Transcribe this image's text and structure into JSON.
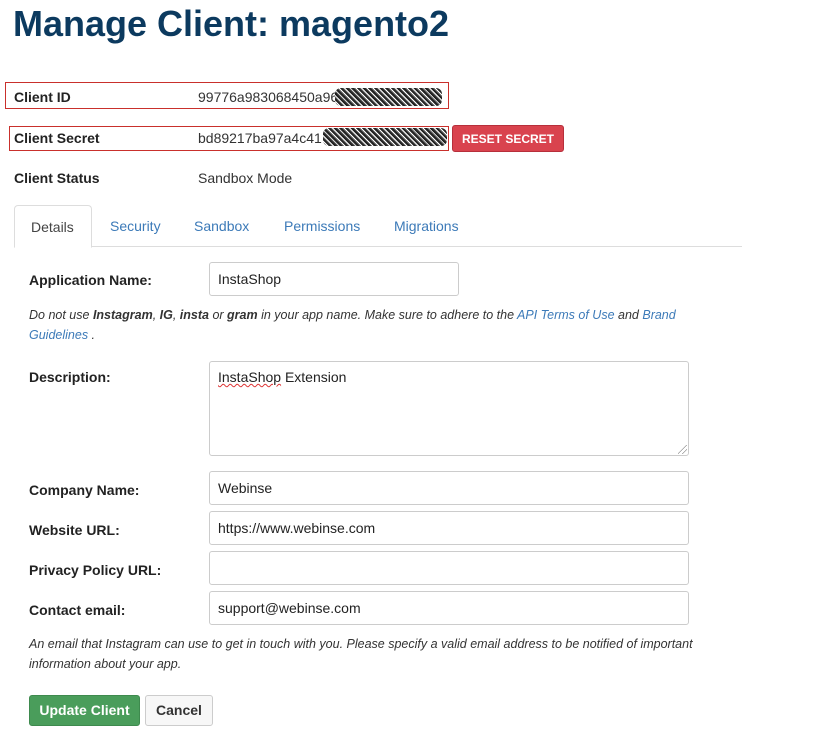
{
  "header": {
    "title": "Manage Client: magento2"
  },
  "client_info": {
    "id_label": "Client ID",
    "id_value": "99776a983068450a96",
    "secret_label": "Client Secret",
    "secret_value": "bd89217ba97a4c41",
    "reset_button": "RESET SECRET",
    "status_label": "Client Status",
    "status_value": "Sandbox Mode"
  },
  "tabs": [
    {
      "label": "Details",
      "active": true
    },
    {
      "label": "Security",
      "active": false
    },
    {
      "label": "Sandbox",
      "active": false
    },
    {
      "label": "Permissions",
      "active": false
    },
    {
      "label": "Migrations",
      "active": false
    }
  ],
  "form": {
    "app_name_label": "Application Name:",
    "app_name_value": "InstaShop",
    "app_name_help": {
      "part1": "Do not use ",
      "instagram": "Instagram",
      "sep1": ", ",
      "ig": "IG",
      "sep2": ", ",
      "insta": "insta",
      "or": " or ",
      "gram": "gram",
      "part2": " in your app name. Make sure to adhere to the ",
      "api_terms_link": "API Terms of Use",
      "and": " and ",
      "brand_link": "Brand Guidelines",
      "end": " ."
    },
    "description_label": "Description:",
    "description_value_word1": "InstaShop",
    "description_value_word2": " Extension",
    "company_label": "Company Name:",
    "company_value": "Webinse",
    "website_label": "Website URL:",
    "website_value": "https://www.webinse.com",
    "privacy_label": "Privacy Policy URL:",
    "privacy_value": "",
    "contact_label": "Contact email:",
    "contact_value": "support@webinse.com",
    "contact_help": "An email that Instagram can use to get in touch with you. Please specify a valid email address to be notified of important information about your app.",
    "update_button": "Update Client",
    "cancel_button": "Cancel"
  },
  "colors": {
    "title": "#0c3a5f",
    "link": "#3c7ab8",
    "reset": "#d9434e",
    "update": "#4a9d5b",
    "highlight_box": "#c9302c"
  }
}
